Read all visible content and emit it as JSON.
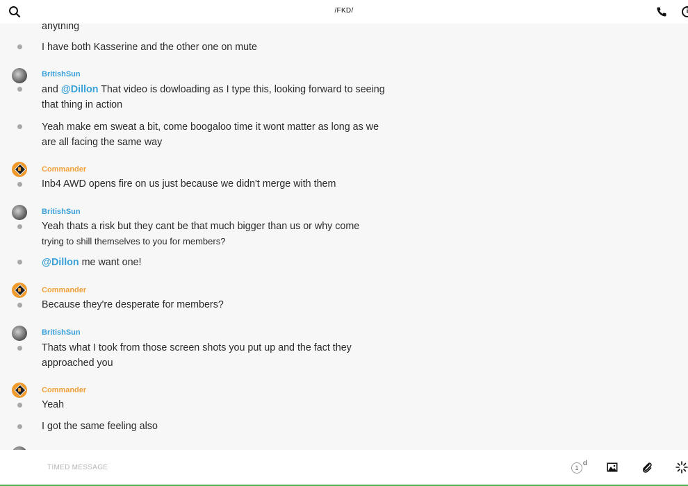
{
  "header": {
    "title": "/FKD/"
  },
  "messages": {
    "m0": {
      "text": "anything"
    },
    "m1": {
      "text": "I have both Kasserine and the other one on mute"
    },
    "g1": {
      "sender": "BritishSun"
    },
    "m2": {
      "prefix": "and ",
      "mention": "@Dillon",
      "text": " That video is dowloading as I type this, looking forward to seeing that thing in action"
    },
    "m3": {
      "text": "Yeah make em sweat a bit, come boogaloo time it wont matter as long as we are all facing the same way"
    },
    "g2": {
      "sender": "Commander"
    },
    "m4": {
      "text": "Inb4 AWD opens fire on us just because we didn't merge with them"
    },
    "g3": {
      "sender": "BritishSun"
    },
    "m5": {
      "text": "Yeah thats a risk but they cant be that much bigger than us or why come",
      "text2": "trying to shill themselves to you for members?"
    },
    "m6": {
      "mention": "@Dillon",
      "text": " me want one!"
    },
    "g4": {
      "sender": "Commander"
    },
    "m7": {
      "text": "Because they're desperate for members?"
    },
    "g5": {
      "sender": "BritishSun"
    },
    "m8": {
      "text": "Thats what I took from those screen shots you put up and the fact they approached you"
    },
    "g6": {
      "sender": "Commander"
    },
    "m9": {
      "text": "Yeah"
    },
    "m10": {
      "text": "I got the same feeling also"
    }
  },
  "composer": {
    "placeholder": "TIMED MESSAGE",
    "timer_value": "1",
    "timer_unit": "d"
  },
  "colors": {
    "mention": "#3aa0d8",
    "british_sender": "#3aa0d8",
    "commander_sender": "#f0a13a",
    "background": "#f7f7f8"
  },
  "icons": [
    "search-icon",
    "phone-icon",
    "info-icon",
    "image-icon",
    "paperclip-icon",
    "loading-icon"
  ]
}
